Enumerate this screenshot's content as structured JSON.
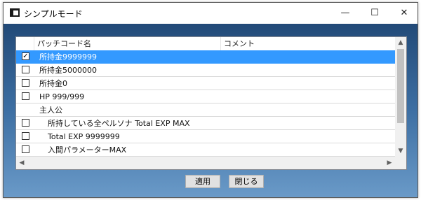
{
  "window": {
    "title": "シンプルモード",
    "icon": "app-window-icon",
    "controls": {
      "minimize": "—",
      "maximize": "☐",
      "close": "✕"
    }
  },
  "list": {
    "headers": {
      "name": "パッチコード名",
      "comment": "コメント"
    },
    "rows": [
      {
        "label": "所持金9999999",
        "checked": true,
        "checkbox": true,
        "indent": false,
        "selected": true
      },
      {
        "label": "所持金5000000",
        "checked": false,
        "checkbox": true,
        "indent": false,
        "selected": false
      },
      {
        "label": "所持金0",
        "checked": false,
        "checkbox": true,
        "indent": false,
        "selected": false
      },
      {
        "label": "HP 999/999",
        "checked": false,
        "checkbox": true,
        "indent": false,
        "selected": false
      },
      {
        "label": "主人公",
        "checked": false,
        "checkbox": false,
        "indent": false,
        "selected": false
      },
      {
        "label": "所持している全ペルソナ Total EXP MAX",
        "checked": false,
        "checkbox": true,
        "indent": true,
        "selected": false
      },
      {
        "label": "Total EXP 9999999",
        "checked": false,
        "checkbox": true,
        "indent": true,
        "selected": false
      },
      {
        "label": "入間パラメーターMAX",
        "checked": false,
        "checkbox": true,
        "indent": true,
        "selected": false
      }
    ]
  },
  "scroll": {
    "up": "▲",
    "down": "▼",
    "left": "◀",
    "right": "▶"
  },
  "buttons": {
    "apply": "適用",
    "close": "閉じる"
  },
  "colors": {
    "selection": "#3399ff",
    "client_top": "#224a78",
    "client_bottom": "#6a9ac8"
  }
}
